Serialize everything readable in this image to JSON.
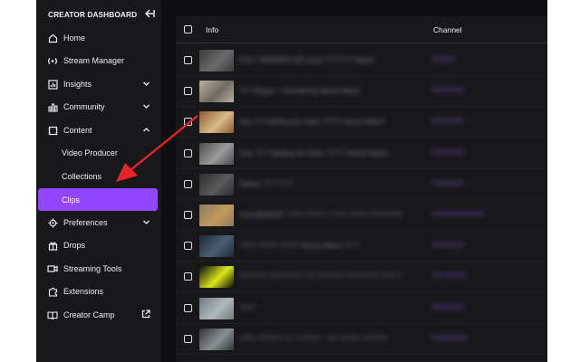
{
  "sidebar": {
    "title": "CREATOR DASHBOARD",
    "collapse_icon": "collapse-left-icon",
    "items": [
      {
        "label": "Home",
        "icon": "home-icon"
      },
      {
        "label": "Stream Manager",
        "icon": "broadcast-icon"
      },
      {
        "label": "Insights",
        "icon": "insights-icon"
      },
      {
        "label": "Community",
        "icon": "community-icon"
      },
      {
        "label": "Content",
        "icon": "content-icon"
      },
      {
        "label": "Video Producer"
      },
      {
        "label": "Collections"
      },
      {
        "label": "Clips"
      },
      {
        "label": "Preferences",
        "icon": "gear-icon"
      },
      {
        "label": "Drops",
        "icon": "drops-icon"
      },
      {
        "label": "Streaming Tools",
        "icon": "camera-icon"
      },
      {
        "label": "Extensions",
        "icon": "puzzle-icon"
      },
      {
        "label": "Creator Camp",
        "icon": "book-icon"
      }
    ]
  },
  "table": {
    "columns": [
      "Info",
      "Channel"
    ],
    "rows": [
      {
        "title": "EOL? WARREN #[Funny] ??????? Watch",
        "channel": "??????"
      },
      {
        "title": "??? Rogue + Something Wood Watch",
        "channel": "????????"
      },
      {
        "title": "Day ?? Fighting the Dark ????? Wood Watch",
        "channel": "????????"
      },
      {
        "title": "Day ??? Fighting the Dark ????? Wood Watch",
        "channel": "????????"
      },
      {
        "title": "Deleet ??? ????",
        "channel": "????????"
      },
      {
        "title": "VOLDEMORT ???? ????? ? ??? ????? ????????",
        "channel": "?????????????"
      },
      {
        "title": "???? ????? ????? Wood Watch ?? ?",
        "channel": "????????"
      },
      {
        "title": "??????! ????????? ?? ??????? ???????? ???? ?",
        "channel": "??? ?????"
      },
      {
        "title": "????",
        "channel": "????????"
      },
      {
        "title": "???? ?????? ?? ? ????? - ??? ????? ??????",
        "channel": "?????????"
      }
    ]
  },
  "colors": {
    "accent": "#9147ff",
    "sidebar_bg": "#18181b",
    "arrow": "#e8232a"
  }
}
